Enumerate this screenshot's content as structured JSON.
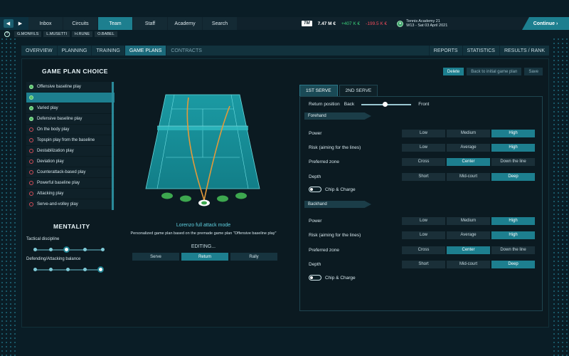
{
  "nav": {
    "back": "◀",
    "forward": "▶",
    "tabs": [
      "Inbox",
      "Circuits",
      "Team",
      "Staff",
      "Academy",
      "Search"
    ],
    "active": "Team",
    "logo": "TM",
    "balance": "7.47 M €",
    "income": "+407 K €",
    "expense": "-199.5 K €",
    "club_name": "Tennis Academy 21",
    "date": "W13 - Sat 03 April 2021",
    "continue": "Continue"
  },
  "players": [
    "G.MONFILS",
    "L.MUSETTI",
    "H.RUNE",
    "O.BABEL"
  ],
  "subnav": {
    "left": [
      "OVERVIEW",
      "PLANNING",
      "TRAINING",
      "GAME PLANS",
      "CONTRACTS"
    ],
    "active": "GAME PLANS",
    "right": [
      "REPORTS",
      "STATISTICS",
      "RESULTS / RANK"
    ]
  },
  "game_plan_choice": {
    "title": "GAME PLAN CHOICE",
    "plans": [
      {
        "label": "Offensive baseline play",
        "status": "green",
        "selected": false
      },
      {
        "label": "",
        "status": "green",
        "selected": true
      },
      {
        "label": "Varied play",
        "status": "green",
        "selected": false
      },
      {
        "label": "Defensive baseline play",
        "status": "green",
        "selected": false
      },
      {
        "label": "On the body play",
        "status": "red",
        "selected": false
      },
      {
        "label": "Topspin play from the baseline",
        "status": "red",
        "selected": false
      },
      {
        "label": "Destabilization play",
        "status": "red",
        "selected": false
      },
      {
        "label": "Deviation play",
        "status": "red",
        "selected": false
      },
      {
        "label": "Counterattack-based play",
        "status": "red",
        "selected": false
      },
      {
        "label": "Powerful baseline play",
        "status": "red",
        "selected": false
      },
      {
        "label": "Attacking play",
        "status": "red",
        "selected": false
      },
      {
        "label": "Serve-and-volley play",
        "status": "red",
        "selected": false
      }
    ]
  },
  "mentality": {
    "title": "MENTALITY",
    "tactical_discipline": {
      "label": "Tactical discipline",
      "steps": 5,
      "value": 3
    },
    "balance": {
      "label": "Defending/Attacking balance",
      "steps": 5,
      "value": 5
    }
  },
  "plan_detail": {
    "name": "Lorenzo full attack mode",
    "description": "Personalized game plan based on the premade game plan \"Offensive baseline play\"",
    "editing": "EDITING...",
    "modes": [
      "Serve",
      "Return",
      "Rally"
    ],
    "active_mode": "Return"
  },
  "actions": {
    "delete": "Delete",
    "back_initial": "Back to initial game plan",
    "save": "Save"
  },
  "serve_tabs": [
    "1ST SERVE",
    "2ND SERVE"
  ],
  "active_serve_tab": "1ST SERVE",
  "return_position": {
    "label": "Return position",
    "back": "Back",
    "front": "Front",
    "value": 0.43
  },
  "forehand": {
    "title": "Forehand",
    "rows": [
      {
        "label": "Power",
        "options": [
          "Low",
          "Medium",
          "High"
        ],
        "selected": 2
      },
      {
        "label": "Risk (aiming for the lines)",
        "options": [
          "Low",
          "Average",
          "High"
        ],
        "selected": 2
      },
      {
        "label": "Preferred zone",
        "options": [
          "Cross",
          "Center",
          "Down the line"
        ],
        "selected": 1
      },
      {
        "label": "Depth",
        "options": [
          "Short",
          "Mid-court",
          "Deep"
        ],
        "selected": 2
      }
    ],
    "chip": {
      "label": "Chip & Charge",
      "on": false
    }
  },
  "backhand": {
    "title": "Backhand",
    "rows": [
      {
        "label": "Power",
        "options": [
          "Low",
          "Medium",
          "High"
        ],
        "selected": 2
      },
      {
        "label": "Risk (aiming for the lines)",
        "options": [
          "Low",
          "Average",
          "High"
        ],
        "selected": 2
      },
      {
        "label": "Preferred zone",
        "options": [
          "Cross",
          "Center",
          "Down the line"
        ],
        "selected": 1
      },
      {
        "label": "Depth",
        "options": [
          "Short",
          "Mid-court",
          "Deep"
        ],
        "selected": 2
      }
    ],
    "chip": {
      "label": "Chip & Charge",
      "on": false
    }
  },
  "colors": {
    "accent": "#1d7f8f",
    "court": "#1aa3aa",
    "trajectory": "#e39a3a",
    "target": "#3da84f"
  }
}
